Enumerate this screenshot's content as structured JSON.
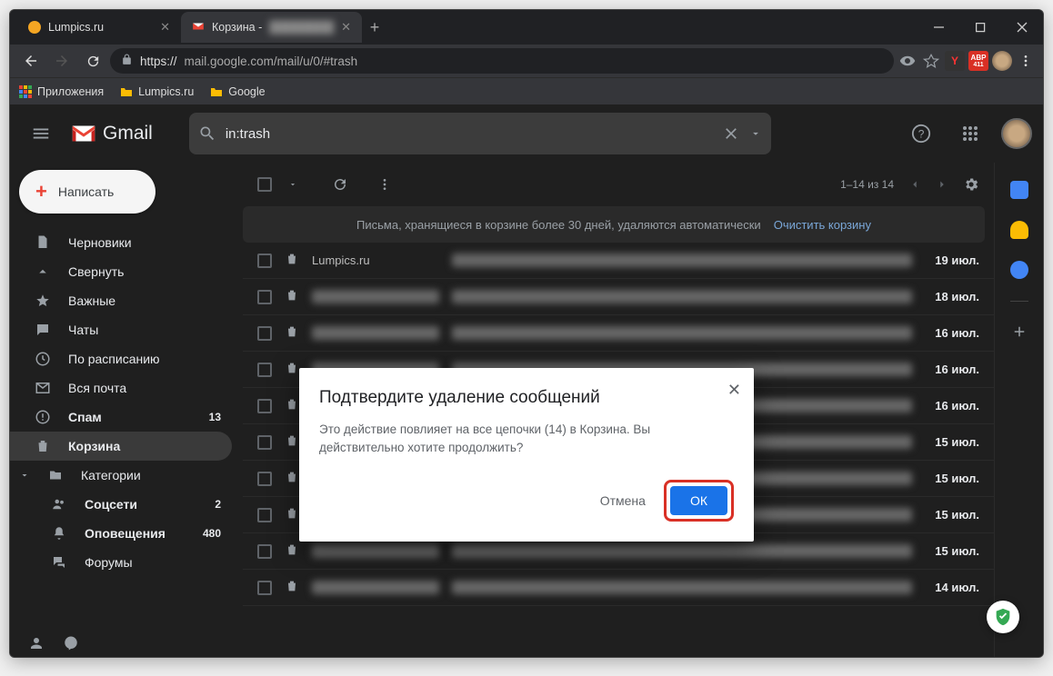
{
  "browser": {
    "tabs": [
      {
        "title": "Lumpics.ru",
        "favicon": "#f5a623"
      },
      {
        "title": "Корзина -",
        "favicon": "gmail",
        "subtitle": "████████"
      }
    ],
    "url_prefix": "https://",
    "url": "mail.google.com/mail/u/0/#trash",
    "bookmarks": {
      "apps": "Приложения",
      "b1": "Lumpics.ru",
      "b2": "Google"
    },
    "ext_badge": "411"
  },
  "gmail": {
    "brand": "Gmail",
    "search_value": "in:trash",
    "compose": "Написать",
    "sidebar": [
      {
        "icon": "file",
        "label": "Черновики"
      },
      {
        "icon": "chev-up",
        "label": "Свернуть"
      },
      {
        "icon": "star",
        "label": "Важные"
      },
      {
        "icon": "chat",
        "label": "Чаты"
      },
      {
        "icon": "clock",
        "label": "По расписанию"
      },
      {
        "icon": "mail",
        "label": "Вся почта"
      },
      {
        "icon": "spam",
        "label": "Спам",
        "count": "13",
        "bold": true
      },
      {
        "icon": "trash",
        "label": "Корзина",
        "selected": true
      },
      {
        "icon": "cat",
        "label": "Категории",
        "caret": true
      },
      {
        "icon": "people",
        "label": "Соцсети",
        "count": "2",
        "bold": true,
        "indent": true
      },
      {
        "icon": "bell",
        "label": "Оповещения",
        "count": "480",
        "bold": true,
        "indent": true
      },
      {
        "icon": "forum",
        "label": "Форумы",
        "indent": true
      }
    ],
    "toolbar": {
      "range": "1–14 из 14"
    },
    "banner": {
      "text": "Письма, хранящиеся в корзине более 30 дней, удаляются автоматически",
      "link": "Очистить корзину"
    },
    "rows": [
      {
        "sender": "Lumpics.ru",
        "date": "19 июл."
      },
      {
        "sender": "████",
        "date": "18 июл."
      },
      {
        "sender": "████",
        "date": "16 июл."
      },
      {
        "sender": "████",
        "date": "16 июл."
      },
      {
        "sender": "████",
        "date": "16 июл."
      },
      {
        "sender": "████",
        "date": "15 июл."
      },
      {
        "sender": "████",
        "date": "15 июл."
      },
      {
        "sender": "████",
        "date": "15 июл."
      },
      {
        "sender": "████",
        "date": "15 июл."
      },
      {
        "sender": "████",
        "date": "14 июл."
      }
    ]
  },
  "modal": {
    "title": "Подтвердите удаление сообщений",
    "body": "Это действие повлияет на все цепочки (14) в Корзина. Вы действительно хотите продолжить?",
    "cancel": "Отмена",
    "ok": "ОК"
  }
}
